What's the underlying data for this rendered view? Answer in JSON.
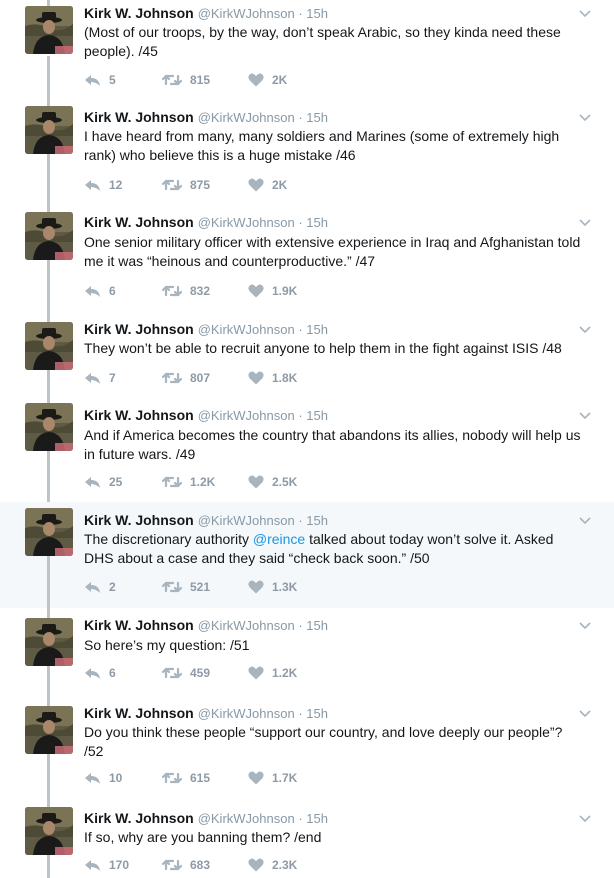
{
  "author": {
    "name": "Kirk W. Johnson",
    "handle": "@KirkWJohnson",
    "time": "15h"
  },
  "colors": {
    "link": "#1b95e0",
    "muted": "#8899a6",
    "thread": "#bcc3c9",
    "highlight": "#f5f8fa"
  },
  "tweets": [
    {
      "lines": [
        "(Most of our troops, by the way, don’t speak Arabic, so they kinda need these",
        "people). /45"
      ],
      "replies": "5",
      "retweets": "815",
      "likes": "2K"
    },
    {
      "lines": [
        "I have heard from many, many soldiers and Marines (some of extremely high",
        "rank) who believe this is a huge mistake /46"
      ],
      "replies": "12",
      "retweets": "875",
      "likes": "2K"
    },
    {
      "lines": [
        "One senior military officer with extensive experience in Iraq and Afghanistan told",
        "me it was “heinous and counterproductive.” /47"
      ],
      "replies": "6",
      "retweets": "832",
      "likes": "1.9K"
    },
    {
      "lines": [
        "They won’t be able to recruit anyone to help them in the fight against ISIS /48"
      ],
      "replies": "7",
      "retweets": "807",
      "likes": "1.8K"
    },
    {
      "lines": [
        "And if America becomes the country that abandons its allies, nobody will help us",
        "in future wars. /49"
      ],
      "replies": "25",
      "retweets": "1.2K",
      "likes": "2.5K"
    },
    {
      "line1_before": "The discretionary authority ",
      "mention": "@reince",
      "line1_after": " talked about today won’t solve it.  Asked",
      "lines": [
        "DHS about a case and they said “check back soon.” /50"
      ],
      "replies": "2",
      "retweets": "521",
      "likes": "1.3K"
    },
    {
      "lines": [
        "So here’s my question: /51"
      ],
      "replies": "6",
      "retweets": "459",
      "likes": "1.2K"
    },
    {
      "lines": [
        "Do you think these people “support our country, and love deeply our people”?",
        "/52"
      ],
      "replies": "10",
      "retweets": "615",
      "likes": "1.7K"
    },
    {
      "lines": [
        "If so, why are you banning them?  /end"
      ],
      "replies": "170",
      "retweets": "683",
      "likes": "2.3K"
    }
  ]
}
